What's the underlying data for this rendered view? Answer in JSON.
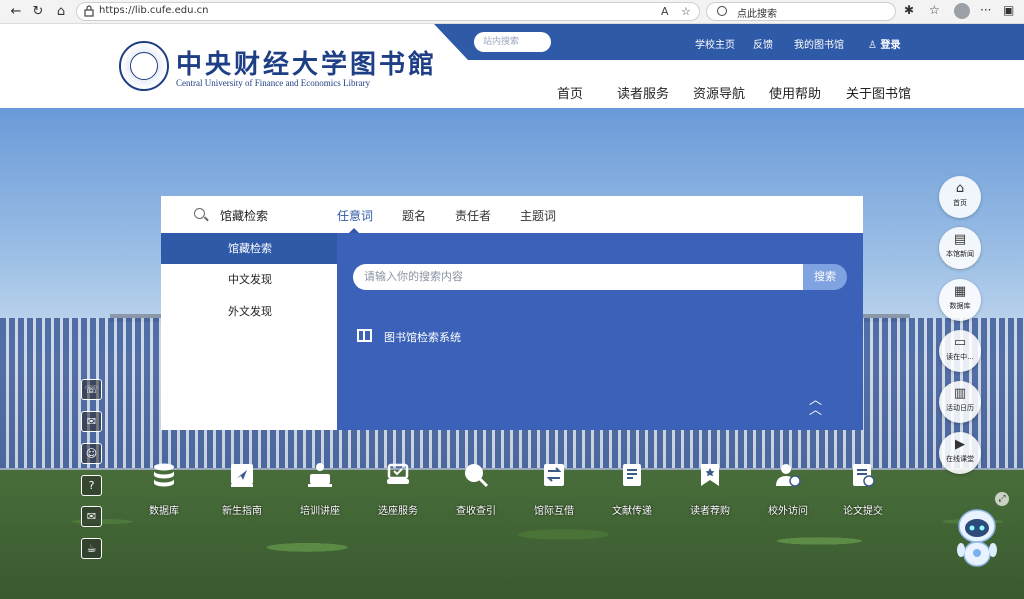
{
  "browser": {
    "url": "https://lib.cufe.edu.cn",
    "search_placeholder": "点此搜索",
    "reader_icon_label": "A"
  },
  "header": {
    "site_search_placeholder": "站内搜索",
    "top_links": [
      "学校主页",
      "反馈",
      "我的图书馆"
    ],
    "login": "登录",
    "logo_cn": "中央财经大学图书館",
    "logo_en": "Central University of Finance and Economics Library",
    "nav": [
      "首页",
      "读者服务",
      "资源导航",
      "使用帮助",
      "关于图书馆"
    ]
  },
  "search": {
    "category_label": "馆藏检索",
    "tabs": [
      "任意词",
      "题名",
      "责任者",
      "主题词"
    ],
    "active_tab": "任意词",
    "left_menu": [
      "馆藏检索",
      "中文发现",
      "外文发现"
    ],
    "input_placeholder": "请输入你的搜索内容",
    "button": "搜索",
    "system_link": "图书馆检索系统"
  },
  "services": [
    "数据库",
    "新生指南",
    "培训讲座",
    "选座服务",
    "查收查引",
    "馆际互借",
    "文献传递",
    "读者荐购",
    "校外访问",
    "论文提交"
  ],
  "side_menu": [
    "首页",
    "本馆新闻",
    "数据库",
    "读在中...",
    "活动日历",
    "在线课堂"
  ],
  "colors": {
    "primary": "#2f5aa8",
    "panel": "#3b62b8"
  }
}
